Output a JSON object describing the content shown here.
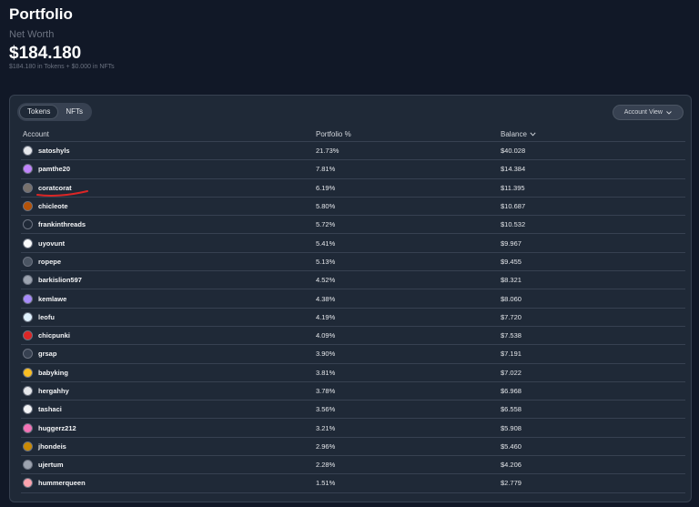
{
  "header": {
    "title": "Portfolio",
    "net_worth_label": "Net Worth",
    "net_worth_value": "$184.180",
    "net_worth_breakdown": "$184.180 in Tokens + $0.000 in NFTs"
  },
  "tabs": [
    {
      "label": "Tokens",
      "active": true
    },
    {
      "label": "NFTs",
      "active": false
    }
  ],
  "account_view": {
    "label": "Account View",
    "icon": "chevron-down-icon"
  },
  "table": {
    "columns": [
      "Account",
      "Portfolio %",
      "Balance"
    ],
    "sort_icon": "chevron-down-icon",
    "rows": [
      {
        "account": "satoshyls",
        "pct": "21.73%",
        "balance": "$40.028",
        "avatar_color": "#e5e7eb"
      },
      {
        "account": "pamthe20",
        "pct": "7.81%",
        "balance": "$14.384",
        "avatar_color": "#c084fc"
      },
      {
        "account": "coratcorat",
        "pct": "6.19%",
        "balance": "$11.395",
        "avatar_color": "#78716c"
      },
      {
        "account": "chicleote",
        "pct": "5.80%",
        "balance": "$10.687",
        "avatar_color": "#b45309"
      },
      {
        "account": "frankinthreads",
        "pct": "5.72%",
        "balance": "$10.532",
        "avatar_color": "#1f2937"
      },
      {
        "account": "uyovunt",
        "pct": "5.41%",
        "balance": "$9.967",
        "avatar_color": "#f9fafb"
      },
      {
        "account": "ropepe",
        "pct": "5.13%",
        "balance": "$9.455",
        "avatar_color": "#4b5563"
      },
      {
        "account": "barkislion597",
        "pct": "4.52%",
        "balance": "$8.321",
        "avatar_color": "#9ca3af"
      },
      {
        "account": "kemlawe",
        "pct": "4.38%",
        "balance": "$8.060",
        "avatar_color": "#a78bfa"
      },
      {
        "account": "leofu",
        "pct": "4.19%",
        "balance": "$7.720",
        "avatar_color": "#e0f2fe"
      },
      {
        "account": "chicpunki",
        "pct": "4.09%",
        "balance": "$7.538",
        "avatar_color": "#dc2626"
      },
      {
        "account": "grsap",
        "pct": "3.90%",
        "balance": "$7.191",
        "avatar_color": "#374151"
      },
      {
        "account": "babyking",
        "pct": "3.81%",
        "balance": "$7.022",
        "avatar_color": "#fbbf24"
      },
      {
        "account": "hergahhy",
        "pct": "3.78%",
        "balance": "$6.968",
        "avatar_color": "#e5e7eb"
      },
      {
        "account": "tashaci",
        "pct": "3.56%",
        "balance": "$6.558",
        "avatar_color": "#f3f4f6"
      },
      {
        "account": "huggerz212",
        "pct": "3.21%",
        "balance": "$5.908",
        "avatar_color": "#f472b6"
      },
      {
        "account": "jhondeis",
        "pct": "2.96%",
        "balance": "$5.460",
        "avatar_color": "#ca8a04"
      },
      {
        "account": "ujertum",
        "pct": "2.28%",
        "balance": "$4.206",
        "avatar_color": "#9ca3af"
      },
      {
        "account": "hummerqueen",
        "pct": "1.51%",
        "balance": "$2.779",
        "avatar_color": "#fda4af"
      }
    ]
  },
  "annotation": {
    "color": "#dc2626",
    "marks": "coratcorat"
  }
}
